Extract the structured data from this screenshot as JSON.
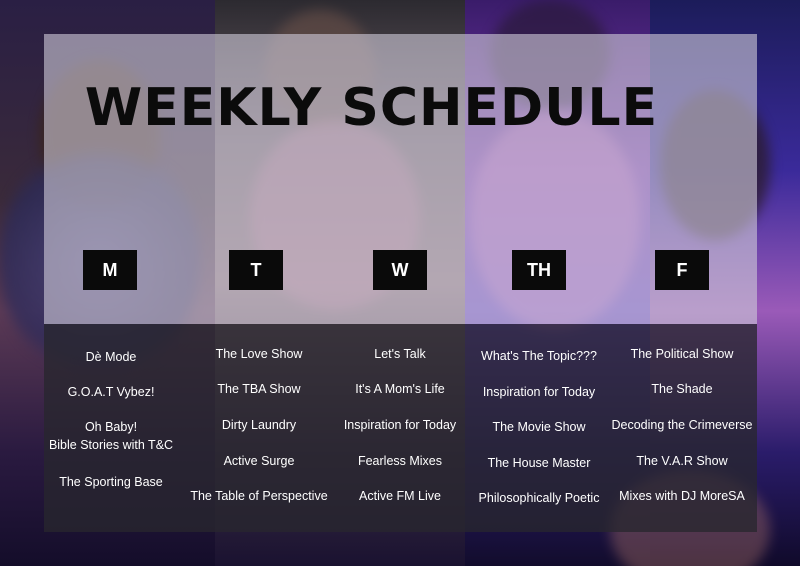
{
  "header": {
    "title": "WEEKLY SCHEDULE"
  },
  "days": [
    {
      "label": "M",
      "shows": [
        "Dè Mode",
        "G.O.A.T Vybez!",
        "Oh Baby!\nBible Stories with T&C",
        "The Sporting Base"
      ]
    },
    {
      "label": "T",
      "shows": [
        "The Love Show",
        "The TBA Show",
        "Dirty Laundry",
        "Active Surge",
        "The Table of Perspective"
      ]
    },
    {
      "label": "W",
      "shows": [
        "Let's Talk",
        "It's A Mom's Life",
        "Inspiration for Today",
        "Fearless Mixes",
        "Active FM Live"
      ]
    },
    {
      "label": "TH",
      "shows": [
        "What's The Topic???",
        "Inspiration for Today",
        "The Movie Show",
        "The House Master",
        "Philosophically Poetic"
      ]
    },
    {
      "label": "F",
      "shows": [
        "The Political Show",
        "The Shade",
        "Decoding the Crimeverse",
        "The V.A.R Show",
        "Mixes with DJ MoreSA"
      ]
    }
  ],
  "colors": {
    "badge": "#0a0a0a",
    "title": "#0b0b0b",
    "text": "#ffffff"
  }
}
